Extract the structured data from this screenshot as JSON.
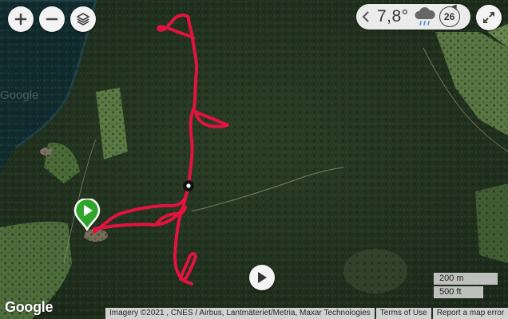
{
  "controls": {
    "zoom_in_icon": "plus-icon",
    "zoom_out_icon": "minus-icon",
    "layers_icon": "layers-icon",
    "fullscreen_icon": "fullscreen-icon"
  },
  "weather": {
    "temperature": "7,8°",
    "condition_icon": "rain-cloud-icon",
    "wind": "26"
  },
  "map": {
    "watermark": "Google",
    "route_color": "#e2143f",
    "start_marker_color": "#2fa52b"
  },
  "scale": {
    "metric": "200 m",
    "imperial": "500 ft"
  },
  "footer": {
    "google_logo": "Google",
    "imagery": "Imagery ©2021 , CNES / Airbus, Lantmäteriet/Metria, Maxar Technologies",
    "terms": "Terms of Use",
    "report": "Report a map error"
  }
}
